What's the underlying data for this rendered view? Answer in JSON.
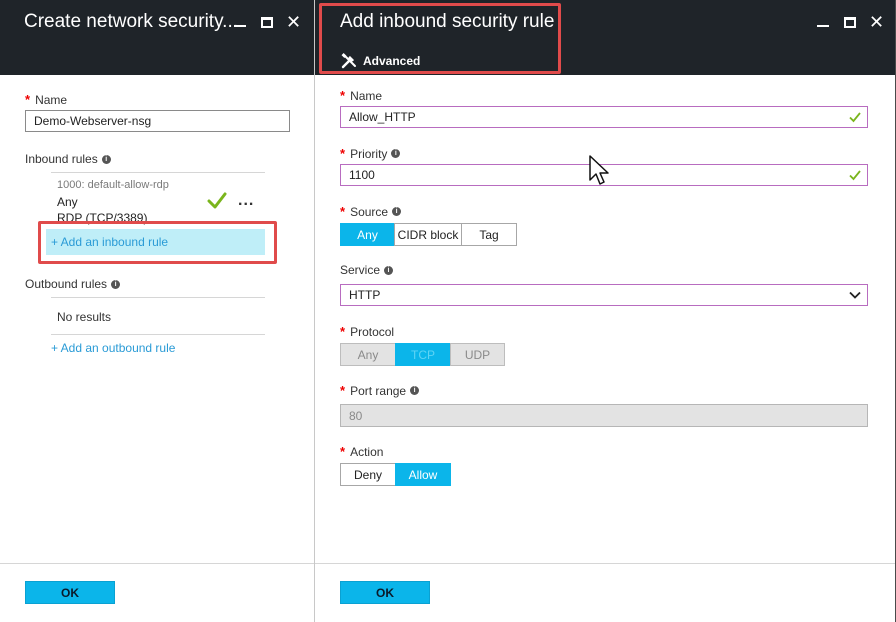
{
  "left_blade": {
    "title": "Create network security...",
    "name_field": {
      "label": "Name",
      "value": "Demo-Webserver-nsg"
    },
    "inbound_rules": {
      "label": "Inbound rules",
      "rule": {
        "title": "1000: default-allow-rdp",
        "source": "Any",
        "protocol": "RDP (TCP/3389)",
        "more": "..."
      },
      "add_link": "+ Add an inbound rule"
    },
    "outbound_rules": {
      "label": "Outbound rules",
      "empty": "No results",
      "add_link": "+ Add an outbound rule"
    },
    "ok_label": "OK"
  },
  "right_blade": {
    "title": "Add inbound security rule",
    "advanced_label": "Advanced",
    "name": {
      "label": "Name",
      "value": "Allow_HTTP"
    },
    "priority": {
      "label": "Priority",
      "value": "1100"
    },
    "source": {
      "label": "Source",
      "options": [
        "Any",
        "CIDR block",
        "Tag"
      ],
      "selected": "Any"
    },
    "service": {
      "label": "Service",
      "value": "HTTP"
    },
    "protocol": {
      "label": "Protocol",
      "options": [
        "Any",
        "TCP",
        "UDP"
      ],
      "selected": "TCP"
    },
    "port_range": {
      "label": "Port range",
      "value": "80"
    },
    "action": {
      "label": "Action",
      "options": [
        "Deny",
        "Allow"
      ],
      "selected": "Allow"
    },
    "ok_label": "OK"
  },
  "window_controls": {
    "minimize": "minimize-icon",
    "maximize": "maximize-icon",
    "close": "close-icon"
  },
  "colors": {
    "header_bg": "#1f2429",
    "accent": "#0bb5ea",
    "link": "#2a9bd6",
    "highlight": "#bfeef8",
    "valid_check": "#7ab51d",
    "required": "#e00000",
    "annotation_red": "#e04b4b"
  }
}
